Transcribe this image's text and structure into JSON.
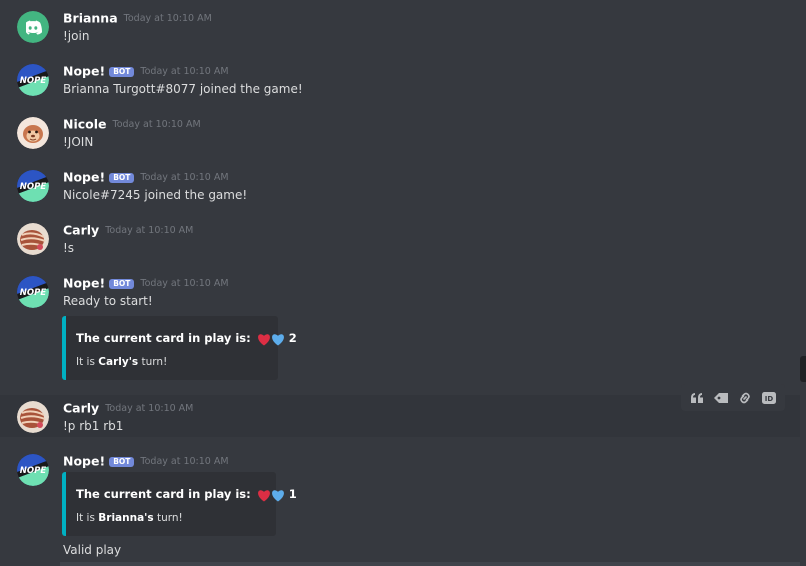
{
  "messages": [
    {
      "author": "Brianna",
      "timestamp": "Today at 10:10 AM",
      "content": "!join",
      "avatar": "discord-logo-avatar"
    },
    {
      "author": "Nope!",
      "bot_tag": "BOT",
      "timestamp": "Today at 10:10 AM",
      "content": "Brianna Turgott#8077 joined the game!",
      "avatar": "nope-bot-avatar",
      "avatar_text": "NOPE"
    },
    {
      "author": "Nicole",
      "timestamp": "Today at 10:10 AM",
      "content": "!JOIN",
      "avatar": "cartoon-face-avatar"
    },
    {
      "author": "Nope!",
      "bot_tag": "BOT",
      "timestamp": "Today at 10:10 AM",
      "content": "Nicole#7245 joined the game!",
      "avatar": "nope-bot-avatar",
      "avatar_text": "NOPE"
    },
    {
      "author": "Carly",
      "timestamp": "Today at 10:10 AM",
      "content": "!s",
      "avatar": "pokemon-avatar"
    },
    {
      "author": "Nope!",
      "bot_tag": "BOT",
      "timestamp": "Today at 10:10 AM",
      "content": "Ready to start!",
      "avatar": "nope-bot-avatar",
      "avatar_text": "NOPE",
      "embed": {
        "title": "The current card in play is:",
        "value": "2",
        "desc_prefix": "It is ",
        "desc_player": "Carly's",
        "desc_suffix": " turn!",
        "hearts": [
          "red-heart",
          "blue-heart"
        ]
      }
    },
    {
      "author": "Carly",
      "timestamp": "Today at 10:10 AM",
      "content": "!p rb1 rb1",
      "avatar": "pokemon-avatar",
      "hovered": true
    },
    {
      "author": "Nope!",
      "bot_tag": "BOT",
      "timestamp": "Today at 10:10 AM",
      "content": "Valid play",
      "avatar": "nope-bot-avatar",
      "avatar_text": "NOPE",
      "embed": {
        "title": "The current card in play is:",
        "value": "1",
        "desc_prefix": "It is ",
        "desc_player": "Brianna's",
        "desc_suffix": " turn!",
        "hearts": [
          "red-heart",
          "blue-heart"
        ]
      }
    }
  ],
  "toolbar": {
    "items": [
      {
        "icon": "quote-icon"
      },
      {
        "icon": "tag-icon"
      },
      {
        "icon": "link-icon"
      },
      {
        "icon": "copy-id-icon",
        "text": "ID"
      }
    ]
  },
  "colors": {
    "background": "#36393f",
    "embed_border": "#00b0c2",
    "embed_background": "#2f3136",
    "bot_tag": "#7289da",
    "red_heart": "#dd2e44",
    "blue_heart": "#5dadec"
  }
}
